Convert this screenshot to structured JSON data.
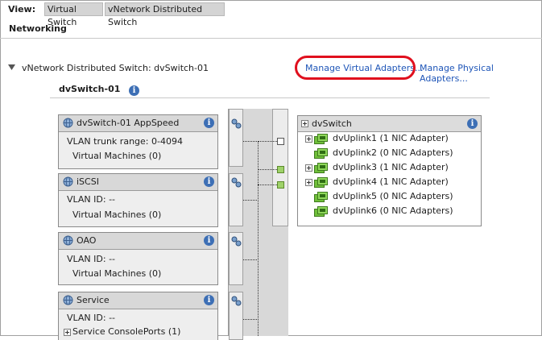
{
  "view": {
    "label": "View:",
    "buttons": [
      "Virtual Switch",
      "vNetwork Distributed Switch"
    ]
  },
  "section_title": "Networking",
  "switch_header": {
    "title": "vNetwork Distributed Switch: dvSwitch-01",
    "manage_virtual": "Manage Virtual Adapters...",
    "manage_physical": "Manage Physical Adapters..."
  },
  "switch_name": "dvSwitch-01",
  "portgroups": [
    {
      "name": "dvSwitch-01 AppSpeed",
      "line1": "VLAN trunk range: 0-4094",
      "line2": "Virtual Machines (0)"
    },
    {
      "name": "iSCSI",
      "line1": "VLAN ID: --",
      "line2": "Virtual Machines (0)"
    },
    {
      "name": "OAO",
      "line1": "VLAN ID: --",
      "line2": "Virtual Machines (0)"
    },
    {
      "name": "Service",
      "line1": "VLAN ID: --",
      "line2": "Service ConsolePorts (1)"
    }
  ],
  "dvswitch_panel": {
    "title": "dvSwitch",
    "uplinks": [
      {
        "label": "dvUplink1 (1 NIC Adapter)",
        "expandable": true
      },
      {
        "label": "dvUplink2 (0 NIC Adapters)",
        "expandable": false
      },
      {
        "label": "dvUplink3 (1 NIC Adapter)",
        "expandable": true
      },
      {
        "label": "dvUplink4 (1 NIC Adapter)",
        "expandable": true
      },
      {
        "label": "dvUplink5 (0 NIC Adapters)",
        "expandable": false
      },
      {
        "label": "dvUplink6 (0 NIC Adapters)",
        "expandable": false
      }
    ]
  },
  "colors": {
    "link": "#1f56b8",
    "highlight_oval": "#e0101e",
    "nic_green": "#6fbf3a"
  }
}
